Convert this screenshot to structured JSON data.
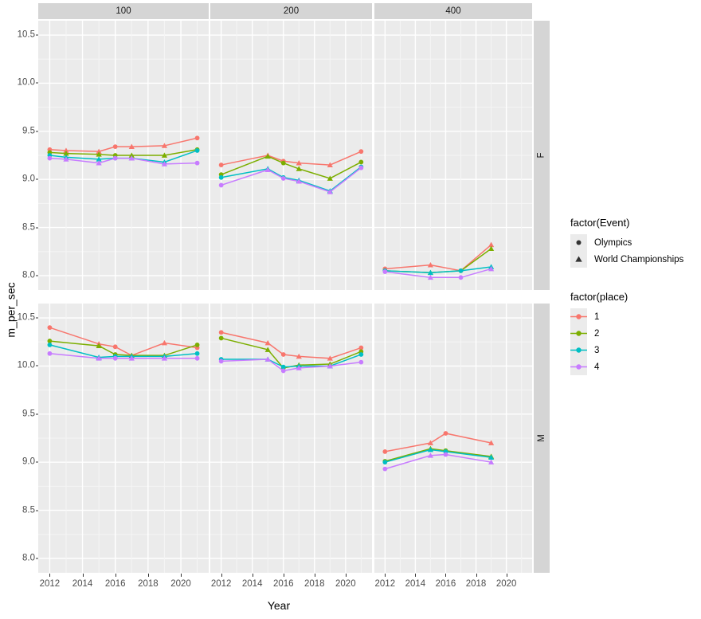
{
  "axes": {
    "y_title": "m_per_sec",
    "x_title": "Year",
    "y_ticks": [
      "10.5",
      "10.0",
      "9.5",
      "9.0",
      "8.5",
      "8.0"
    ],
    "x_ticks": [
      "2012",
      "2014",
      "2016",
      "2018",
      "2020"
    ]
  },
  "facets": {
    "cols": [
      "100",
      "200",
      "400"
    ],
    "rows": [
      "F",
      "M"
    ]
  },
  "legends": [
    {
      "title": "factor(Event)",
      "items": [
        {
          "label": "Olympics",
          "glyph": "circle-icon",
          "color": "#333333"
        },
        {
          "label": "World Championships",
          "glyph": "triangle-icon",
          "color": "#333333"
        }
      ]
    },
    {
      "title": "factor(place)",
      "items": [
        {
          "label": "1",
          "glyph": "line-point-icon",
          "color": "#F8766D"
        },
        {
          "label": "2",
          "glyph": "line-point-icon",
          "color": "#7CAE00"
        },
        {
          "label": "3",
          "glyph": "line-point-icon",
          "color": "#00BFC4"
        },
        {
          "label": "4",
          "glyph": "line-point-icon",
          "color": "#C77CFF"
        }
      ]
    }
  ],
  "chart_data": {
    "type": "line",
    "title": "",
    "xlabel": "Year",
    "ylabel": "m_per_sec",
    "xlim": [
      2011.3,
      2021.7
    ],
    "ylim": [
      7.85,
      10.65
    ],
    "ytick_values": [
      10.5,
      10.0,
      9.5,
      9.0,
      8.5,
      8.0
    ],
    "xtick_values": [
      2012,
      2014,
      2016,
      2018,
      2020
    ],
    "grid": true,
    "legend_position": "right",
    "facet_col_var": "distance",
    "facet_row_var": "sex",
    "color_var": "factor(place)",
    "shape_var": "factor(Event)",
    "colors": {
      "1": "#F8766D",
      "2": "#7CAE00",
      "3": "#00BFC4",
      "4": "#C77CFF"
    },
    "shapes": {
      "Olympics": "circle",
      "World Championships": "triangle"
    },
    "panels": [
      {
        "sex": "F",
        "distance": "100",
        "series": [
          {
            "name": "1",
            "x": [
              2012,
              2013,
              2015,
              2016,
              2017,
              2019,
              2021
            ],
            "events": [
              "Olympics",
              "World Championships",
              "World Championships",
              "Olympics",
              "World Championships",
              "World Championships",
              "Olympics"
            ],
            "values": [
              9.31,
              9.3,
              9.29,
              9.34,
              9.34,
              9.35,
              9.43
            ]
          },
          {
            "name": "2",
            "x": [
              2012,
              2013,
              2015,
              2016,
              2017,
              2019,
              2021
            ],
            "events": [
              "Olympics",
              "World Championships",
              "World Championships",
              "Olympics",
              "World Championships",
              "World Championships",
              "Olympics"
            ],
            "values": [
              9.28,
              9.27,
              9.26,
              9.25,
              9.25,
              9.25,
              9.31
            ]
          },
          {
            "name": "3",
            "x": [
              2012,
              2013,
              2015,
              2016,
              2017,
              2019,
              2021
            ],
            "events": [
              "Olympics",
              "World Championships",
              "World Championships",
              "Olympics",
              "World Championships",
              "World Championships",
              "Olympics"
            ],
            "values": [
              9.25,
              9.23,
              9.21,
              9.22,
              9.22,
              9.18,
              9.3
            ]
          },
          {
            "name": "4",
            "x": [
              2012,
              2013,
              2015,
              2016,
              2017,
              2019,
              2021
            ],
            "events": [
              "Olympics",
              "World Championships",
              "World Championships",
              "Olympics",
              "World Championships",
              "World Championships",
              "Olympics"
            ],
            "values": [
              9.22,
              9.21,
              9.17,
              9.22,
              9.22,
              9.16,
              9.17
            ]
          }
        ]
      },
      {
        "sex": "F",
        "distance": "200",
        "series": [
          {
            "name": "1",
            "x": [
              2012,
              2015,
              2016,
              2017,
              2019,
              2021
            ],
            "events": [
              "Olympics",
              "World Championships",
              "Olympics",
              "World Championships",
              "World Championships",
              "Olympics"
            ],
            "values": [
              9.15,
              9.25,
              9.19,
              9.17,
              9.15,
              9.29
            ]
          },
          {
            "name": "2",
            "x": [
              2012,
              2015,
              2016,
              2017,
              2019,
              2021
            ],
            "events": [
              "Olympics",
              "World Championships",
              "Olympics",
              "World Championships",
              "World Championships",
              "Olympics"
            ],
            "values": [
              9.05,
              9.24,
              9.17,
              9.11,
              9.01,
              9.18
            ]
          },
          {
            "name": "3",
            "x": [
              2012,
              2015,
              2016,
              2017,
              2019,
              2021
            ],
            "events": [
              "Olympics",
              "World Championships",
              "Olympics",
              "World Championships",
              "World Championships",
              "Olympics"
            ],
            "values": [
              9.02,
              9.11,
              9.02,
              8.99,
              8.88,
              9.13
            ]
          },
          {
            "name": "4",
            "x": [
              2012,
              2015,
              2016,
              2017,
              2019,
              2021
            ],
            "events": [
              "Olympics",
              "World Championships",
              "Olympics",
              "World Championships",
              "World Championships",
              "Olympics"
            ],
            "values": [
              8.94,
              9.1,
              9.01,
              8.98,
              8.87,
              9.12
            ]
          }
        ]
      },
      {
        "sex": "F",
        "distance": "400",
        "series": [
          {
            "name": "1",
            "x": [
              2012,
              2015,
              2017,
              2019
            ],
            "events": [
              "Olympics",
              "World Championships",
              "Olympics",
              "World Championships"
            ],
            "values": [
              8.07,
              8.11,
              8.05,
              8.32
            ]
          },
          {
            "name": "2",
            "x": [
              2012,
              2015,
              2017,
              2019
            ],
            "events": [
              "Olympics",
              "World Championships",
              "Olympics",
              "World Championships"
            ],
            "values": [
              8.05,
              8.03,
              8.05,
              8.28
            ]
          },
          {
            "name": "3",
            "x": [
              2012,
              2015,
              2017,
              2019
            ],
            "events": [
              "Olympics",
              "World Championships",
              "Olympics",
              "World Championships"
            ],
            "values": [
              8.05,
              8.03,
              8.05,
              8.09
            ]
          },
          {
            "name": "4",
            "x": [
              2012,
              2015,
              2017,
              2019
            ],
            "events": [
              "Olympics",
              "World Championships",
              "Olympics",
              "World Championships"
            ],
            "values": [
              8.04,
              7.98,
              7.98,
              8.07
            ]
          }
        ]
      },
      {
        "sex": "M",
        "distance": "100",
        "series": [
          {
            "name": "1",
            "x": [
              2012,
              2015,
              2016,
              2017,
              2019,
              2021
            ],
            "events": [
              "Olympics",
              "World Championships",
              "Olympics",
              "World Championships",
              "World Championships",
              "Olympics"
            ],
            "values": [
              10.4,
              10.23,
              10.2,
              10.11,
              10.24,
              10.19
            ]
          },
          {
            "name": "2",
            "x": [
              2012,
              2015,
              2016,
              2017,
              2019,
              2021
            ],
            "events": [
              "Olympics",
              "World Championships",
              "Olympics",
              "World Championships",
              "World Championships",
              "Olympics"
            ],
            "values": [
              10.26,
              10.21,
              10.12,
              10.11,
              10.11,
              10.22
            ]
          },
          {
            "name": "3",
            "x": [
              2012,
              2015,
              2016,
              2017,
              2019,
              2021
            ],
            "events": [
              "Olympics",
              "World Championships",
              "Olympics",
              "World Championships",
              "World Championships",
              "Olympics"
            ],
            "values": [
              10.22,
              10.09,
              10.1,
              10.1,
              10.1,
              10.13
            ]
          },
          {
            "name": "4",
            "x": [
              2012,
              2015,
              2016,
              2017,
              2019,
              2021
            ],
            "events": [
              "Olympics",
              "World Championships",
              "Olympics",
              "World Championships",
              "World Championships",
              "Olympics"
            ],
            "values": [
              10.13,
              10.08,
              10.08,
              10.08,
              10.08,
              10.08
            ]
          }
        ]
      },
      {
        "sex": "M",
        "distance": "200",
        "series": [
          {
            "name": "1",
            "x": [
              2012,
              2015,
              2016,
              2017,
              2019,
              2021
            ],
            "events": [
              "Olympics",
              "World Championships",
              "Olympics",
              "World Championships",
              "World Championships",
              "Olympics"
            ],
            "values": [
              10.35,
              10.24,
              10.12,
              10.1,
              10.08,
              10.19
            ]
          },
          {
            "name": "2",
            "x": [
              2012,
              2015,
              2016,
              2017,
              2019,
              2021
            ],
            "events": [
              "Olympics",
              "World Championships",
              "Olympics",
              "World Championships",
              "World Championships",
              "Olympics"
            ],
            "values": [
              10.29,
              10.17,
              9.98,
              10.01,
              10.02,
              10.15
            ]
          },
          {
            "name": "3",
            "x": [
              2012,
              2015,
              2016,
              2017,
              2019,
              2021
            ],
            "events": [
              "Olympics",
              "World Championships",
              "Olympics",
              "World Championships",
              "World Championships",
              "Olympics"
            ],
            "values": [
              10.07,
              10.07,
              9.99,
              10.0,
              10.0,
              10.12
            ]
          },
          {
            "name": "4",
            "x": [
              2012,
              2015,
              2016,
              2017,
              2019,
              2021
            ],
            "events": [
              "Olympics",
              "World Championships",
              "Olympics",
              "World Championships",
              "World Championships",
              "Olympics"
            ],
            "values": [
              10.05,
              10.07,
              9.95,
              9.98,
              10.0,
              10.04
            ]
          }
        ]
      },
      {
        "sex": "M",
        "distance": "400",
        "series": [
          {
            "name": "1",
            "x": [
              2012,
              2015,
              2016,
              2019
            ],
            "events": [
              "Olympics",
              "World Championships",
              "Olympics",
              "World Championships"
            ],
            "values": [
              9.11,
              9.2,
              9.3,
              9.2
            ]
          },
          {
            "name": "2",
            "x": [
              2012,
              2015,
              2016,
              2019
            ],
            "events": [
              "Olympics",
              "World Championships",
              "Olympics",
              "World Championships"
            ],
            "values": [
              9.01,
              9.14,
              9.12,
              9.06
            ]
          },
          {
            "name": "3",
            "x": [
              2012,
              2015,
              2016,
              2019
            ],
            "events": [
              "Olympics",
              "World Championships",
              "Olympics",
              "World Championships"
            ],
            "values": [
              9.0,
              9.13,
              9.11,
              9.05
            ]
          },
          {
            "name": "4",
            "x": [
              2012,
              2015,
              2016,
              2019
            ],
            "events": [
              "Olympics",
              "World Championships",
              "Olympics",
              "World Championships"
            ],
            "values": [
              8.93,
              9.07,
              9.08,
              9.0
            ]
          }
        ]
      }
    ]
  }
}
